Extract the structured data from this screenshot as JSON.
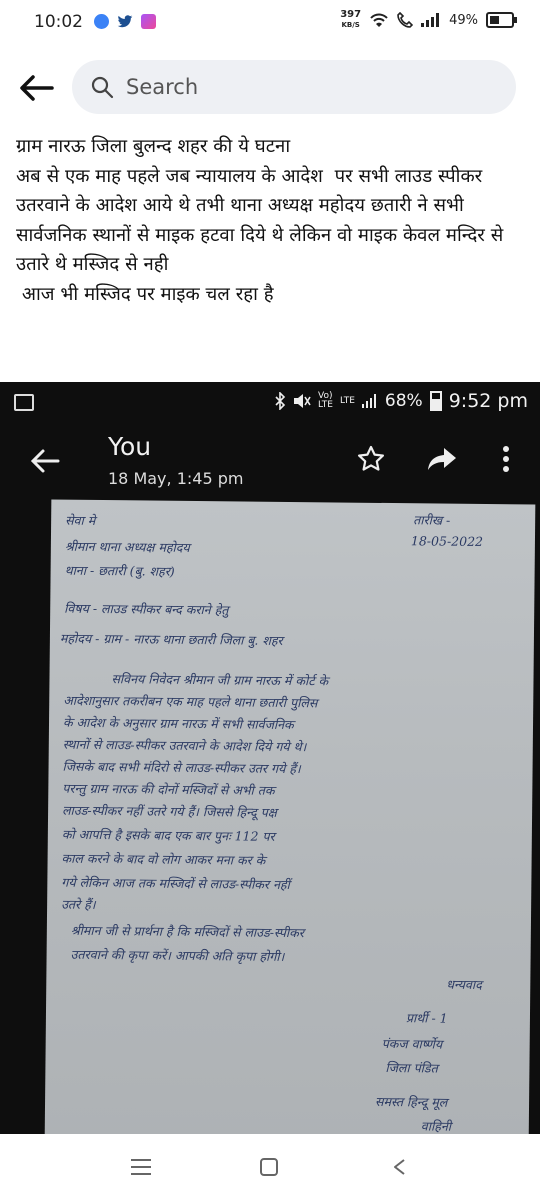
{
  "status_bar": {
    "time": "10:02",
    "speed_value": "397",
    "speed_unit": "KB/S",
    "battery": "49%",
    "app_icons": [
      "app-icon-blue",
      "twitter-icon",
      "app-icon-purple"
    ]
  },
  "search": {
    "placeholder": "Search"
  },
  "post": {
    "text": "ग्राम नारऊ जिला बुलन्द शहर की ये घटना\nअब से एक माह पहले जब न्यायालय के आदेश  पर सभी लाउड स्पीकर उतरवाने के आदेश आये थे तभी थाना अध्यक्ष महोदय छतारी ने सभी सार्वजनिक स्थानों से माइक हटवा दिये थे लेकिन वो माइक केवल मन्दिर से उतारे थे मस्जिद से नही\n आज भी मस्जिद पर माइक चल रहा है"
  },
  "embedded_screenshot": {
    "status": {
      "battery": "68%",
      "time": "9:52 pm",
      "net": "LTE"
    },
    "sender": "You",
    "date": "18 May, 1:45 pm",
    "letter": {
      "date_label": "तारीख -",
      "date_value": "18-05-2022",
      "lines": [
        "सेवा मे",
        "श्रीमान थाना अध्यक्ष महोदय",
        "थाना - छतारी (बु. शहर)",
        "विषय - लाउड स्पीकर बन्द कराने हेतु",
        "महोदय - ग्राम - नारऊ थाना छतारी जिला बु. शहर",
        "सविनय निवेदन श्रीमान जी ग्राम नारऊ में कोर्ट के",
        "आदेशानुसार तकरीबन एक माह पहले थाना छतारी पुलिस",
        "के आदेश के अनुसार ग्राम नारऊ में सभी सार्वजनिक",
        "स्थानों से लाउड-स्पीकर उतरवाने के आदेश दिये गये थे।",
        "जिसके बाद सभी मंदिरो से लाउड-स्पीकर उतर गये हैं।",
        "परन्तु ग्राम नारऊ की दोनों मस्जिदों से अभी तक",
        "लाउड-स्पीकर नहीं उतरे गये हैं। जिससे हिन्दू पक्ष",
        "को आपत्ति है इसके बाद एक बार पुनः 112 पर",
        "काल करने के बाद वो लोग आकर मना कर के",
        "गये लेकिन आज तक मस्जिदों से लाउड-स्पीकर नहीं",
        "उतरे हैं।",
        "श्रीमान जी से प्रार्थना है कि मस्जिदों से लाउड-स्पीकर",
        "उतरवाने की कृपा करें। आपकी अति कृपा होगी।",
        "धन्यवाद",
        "प्रार्थी - 1",
        "पंकज वार्ष्णेय",
        "जिला पंडित",
        "समस्त हिन्दू मूल",
        "वाहिनी"
      ]
    }
  }
}
